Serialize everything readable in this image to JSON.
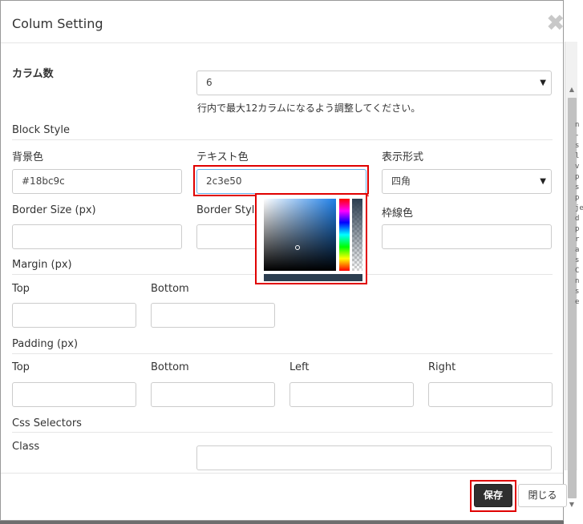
{
  "modal": {
    "title": "Colum Setting",
    "close_icon": "close-icon"
  },
  "columns": {
    "label": "カラム数",
    "value": "6",
    "help": "行内で最大12カラムになるよう調整してください。"
  },
  "block_style": {
    "title": "Block Style",
    "bg_color_label": "背景色",
    "bg_color_value": "#18bc9c",
    "text_color_label": "テキスト色",
    "text_color_value": "2c3e50",
    "display_label": "表示形式",
    "display_value": "四角",
    "border_size_label": "Border Size (px)",
    "border_style_label": "Border Style",
    "border_color_label": "枠線色"
  },
  "margin": {
    "title": "Margin (px)",
    "top_label": "Top",
    "bottom_label": "Bottom"
  },
  "padding": {
    "title": "Padding (px)",
    "top_label": "Top",
    "bottom_label": "Bottom",
    "left_label": "Left",
    "right_label": "Right"
  },
  "css": {
    "title": "Css Selectors",
    "class_label": "Class"
  },
  "color_picker": {
    "selected_color": "#2c3e50"
  },
  "footer": {
    "save_label": "保存",
    "close_label": "閉じる"
  },
  "background_letters": "n\n-\ns\nl\nv\np\ns\np\nje\nd\np\nr\na\ns\nC\nn\ns\ne"
}
